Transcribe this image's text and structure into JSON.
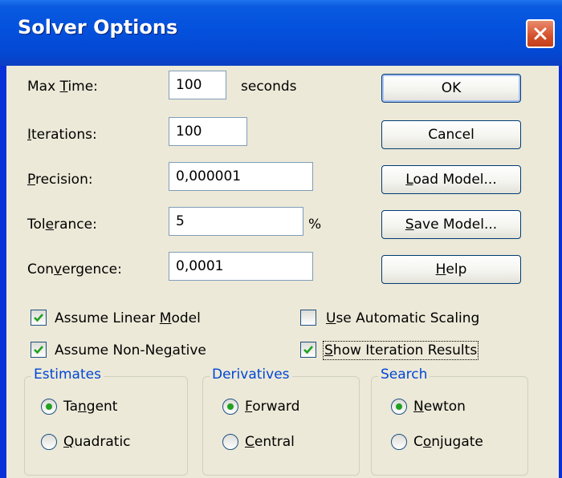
{
  "window": {
    "title": "Solver Options"
  },
  "fields": [
    {
      "pre": "Max ",
      "acc": "T",
      "post": "ime:",
      "value": "100",
      "suffix": "seconds"
    },
    {
      "pre": "",
      "acc": "I",
      "post": "terations:",
      "value": "100",
      "suffix": ""
    },
    {
      "pre": "",
      "acc": "P",
      "post": "recision:",
      "value": "0,000001",
      "suffix": ""
    },
    {
      "pre": "Tol",
      "acc": "e",
      "post": "rance:",
      "value": "5",
      "suffix": "%"
    },
    {
      "pre": "Con",
      "acc": "v",
      "post": "ergence:",
      "value": "0,0001",
      "suffix": ""
    }
  ],
  "buttons": [
    {
      "pre": "OK",
      "acc": "",
      "post": ""
    },
    {
      "pre": "Cancel",
      "acc": "",
      "post": ""
    },
    {
      "pre": "",
      "acc": "L",
      "post": "oad Model..."
    },
    {
      "pre": "",
      "acc": "S",
      "post": "ave Model..."
    },
    {
      "pre": "",
      "acc": "H",
      "post": "elp"
    }
  ],
  "checkboxes": [
    {
      "pre": "Assume Linear ",
      "acc": "M",
      "post": "odel",
      "checked": true
    },
    {
      "pre": "",
      "acc": "U",
      "post": "se Automatic Scaling",
      "checked": false
    },
    {
      "pre": "Assume Non-Ne",
      "acc": "g",
      "post": "ative",
      "checked": true
    },
    {
      "pre": "",
      "acc": "S",
      "post": "how Iteration Results",
      "checked": true
    }
  ],
  "groups": [
    {
      "title": "Estimates",
      "options": [
        {
          "pre": "Ta",
          "acc": "n",
          "post": "gent",
          "selected": true
        },
        {
          "pre": "",
          "acc": "Q",
          "post": "uadratic",
          "selected": false
        }
      ]
    },
    {
      "title": "Derivatives",
      "options": [
        {
          "pre": "",
          "acc": "F",
          "post": "orward",
          "selected": true
        },
        {
          "pre": "",
          "acc": "C",
          "post": "entral",
          "selected": false
        }
      ]
    },
    {
      "title": "Search",
      "options": [
        {
          "pre": "",
          "acc": "N",
          "post": "ewton",
          "selected": true
        },
        {
          "pre": "C",
          "acc": "o",
          "post": "njugate",
          "selected": false
        }
      ]
    }
  ],
  "colors": {
    "title_bar": "#0451dd",
    "client_bg": "#ece9d8",
    "group_title": "#0046d5",
    "check_mark": "#21a121",
    "close_button": "#d5502b"
  },
  "icons": {
    "close": "close-icon",
    "check": "checkmark-icon"
  }
}
